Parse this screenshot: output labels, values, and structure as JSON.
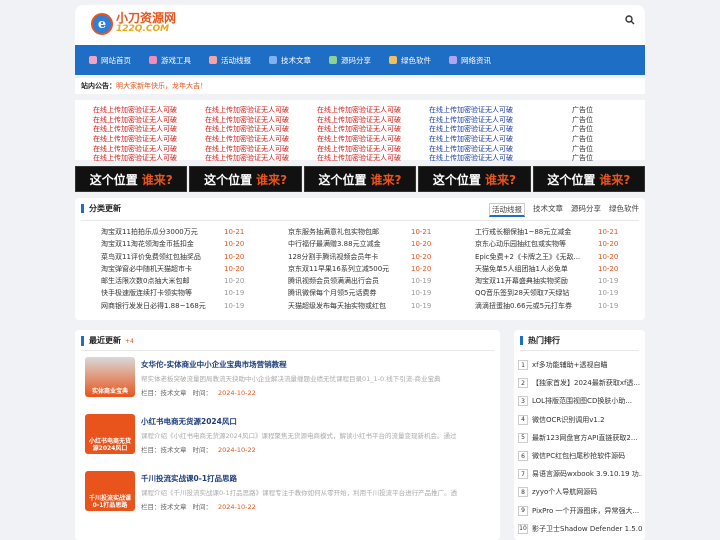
{
  "brand": {
    "name": "小刀资源网",
    "domain": "122Q.COM",
    "logo_letter": "e"
  },
  "nav": [
    {
      "label": "网站首页",
      "color": "#f2a3c0"
    },
    {
      "label": "游戏工具",
      "color": "#f28bb5"
    },
    {
      "label": "活动线报",
      "color": "#f4a4a4"
    },
    {
      "label": "技术文章",
      "color": "#7fb2ef"
    },
    {
      "label": "源码分享",
      "color": "#8fd18f"
    },
    {
      "label": "绿色软件",
      "color": "#f2c05a"
    },
    {
      "label": "网络资讯",
      "color": "#b4a4ef"
    }
  ],
  "notice": {
    "label": "站内公告：",
    "text": "明大家新年快乐，龙年大吉！"
  },
  "ads": {
    "red": "在线上传加密验证无人可破",
    "blue": "在线上传加密验证无人可破",
    "side": "广告位"
  },
  "banner": {
    "a": "这个位置",
    "b": "谁来?"
  },
  "category": {
    "title": "分类更新",
    "tabs": [
      "活动线报",
      "技术文章",
      "源码分享",
      "绿色软件"
    ],
    "col1": [
      {
        "n": "淘宝双11拍拍乐瓜分3000万元",
        "d": "10-21"
      },
      {
        "n": "淘宝双11淘花领淘金币抵扣金",
        "d": "10-20"
      },
      {
        "n": "菜鸟双11评价免费领红包抽奖品",
        "d": "10-20"
      },
      {
        "n": "淘宝弹窗必中随机天猫超市卡",
        "d": "10-20"
      },
      {
        "n": "邮生活限次数0点抽大米包邮",
        "d": "10-20"
      },
      {
        "n": "快手极速版连续打卡领实物等",
        "d": "10-19"
      },
      {
        "n": "网商银行发发日必得1.88~168元",
        "d": "10-19"
      }
    ],
    "col2": [
      {
        "n": "京东服务抽满意礼包实物包邮",
        "d": "10-21"
      },
      {
        "n": "中行福仔最满赠3.88元立减金",
        "d": "10-20"
      },
      {
        "n": "128分割手腾讯视频会员年卡",
        "d": "10-20"
      },
      {
        "n": "京东双11早果16系列立减500元",
        "d": "10-20"
      },
      {
        "n": "腾讯视频会员领满满出行会员",
        "d": "10-19"
      },
      {
        "n": "腾讯微保每个月领5元话费券",
        "d": "10-19"
      },
      {
        "n": "天猫超级发布每天抽实物或红包",
        "d": "10-19"
      }
    ],
    "col3": [
      {
        "n": "工行戒长棚保抽1~88元立减金",
        "d": "10-21"
      },
      {
        "n": "京东心动乐园抽红包或实物等",
        "d": "10-20"
      },
      {
        "n": "Epic免费+2《卡牌之王》《无敌...",
        "d": "10-20"
      },
      {
        "n": "天猫免单5人组团抽1人必免单",
        "d": "10-20"
      },
      {
        "n": "淘宝双11开幕盛典抽实物奖励",
        "d": "10-19"
      },
      {
        "n": "QQ音乐签到28天领取7天绿钻",
        "d": "10-19"
      },
      {
        "n": "滴滴扭蛋抽0.66元或5元打车券",
        "d": "10-19"
      }
    ]
  },
  "latest": {
    "title": "最近更新",
    "badge": "+4",
    "meta_prefix": "栏目：",
    "meta_cat": "技术文章",
    "meta_time_label": "时间：",
    "posts": [
      {
        "title": "女华佗-实体商业中小企业宝典市场营销教程",
        "desc": "帮实体老板突破流量困局教流天抉助中小企业解决流量缠题业绩无忧课程目录01_1-0.线下引流-商业宝典",
        "date": "2024-10-22",
        "thumb_text": "实体商业宝典"
      },
      {
        "title": "小红书电商无货源2024风口",
        "desc": "课程介绍《小红书电商无货源2024风口》课程聚焦无货源电商模式，解读小红书平台的流量变现新机会。通过",
        "date": "2024-10-22",
        "thumb_text": "小红书电商无货源2024风口"
      },
      {
        "title": "千川投流实战课0-1打品思路",
        "desc": "课程介绍《千川投流实战课0-1打品思路》课程专注于教你如何从零开始，利用千川投流平台进行产品推广。透",
        "date": "2024-10-22",
        "thumb_text": "千川投流实战课0-1打品思路"
      }
    ]
  },
  "hot": {
    "title": "热门排行",
    "items": [
      {
        "n": "1",
        "t": "xf多功能辅助+透视自瞄"
      },
      {
        "n": "2",
        "t": "【独家首发】2024最新获取xf透..."
      },
      {
        "n": "3",
        "t": "LOL排版范围视图CD换肤小助..."
      },
      {
        "n": "4",
        "t": "微信OCR识别调用v1.2"
      },
      {
        "n": "5",
        "t": "最新123网盘官方API直链获取2..."
      },
      {
        "n": "6",
        "t": "微信PC红包扫尾秒抢软件源码"
      },
      {
        "n": "7",
        "t": "易语言源码wxbook 3.9.10.19 功..."
      },
      {
        "n": "8",
        "t": "zyyo个人导航网源码"
      },
      {
        "n": "9",
        "t": "PixPro 一个开源图床，异常强大..."
      },
      {
        "n": "10",
        "t": "影子卫士Shadow Defender 1.5.0..."
      }
    ]
  }
}
